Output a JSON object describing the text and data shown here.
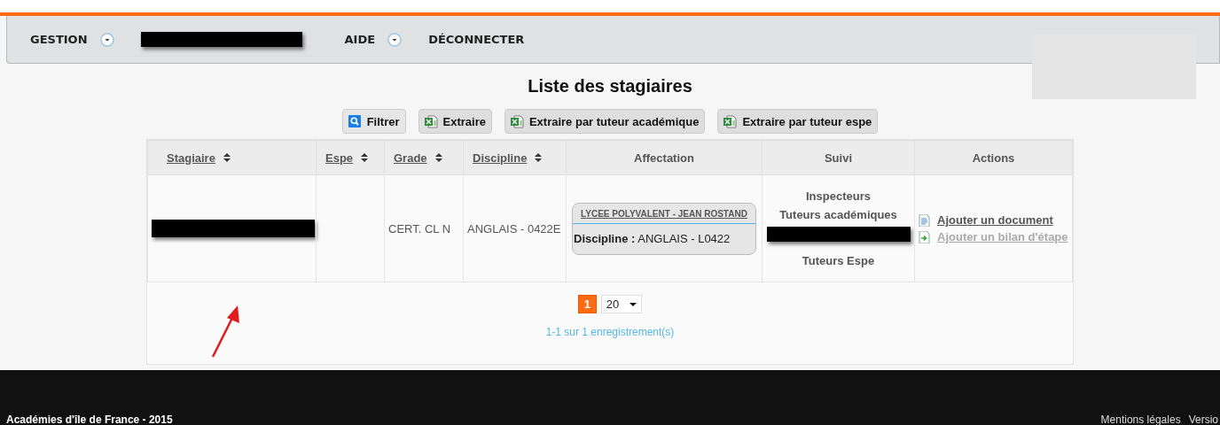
{
  "nav": {
    "items": [
      {
        "kind": "menu",
        "label": "GESTION"
      },
      {
        "kind": "redacted"
      },
      {
        "kind": "menu",
        "label": "AIDE"
      },
      {
        "kind": "link",
        "label": "DÉCONNECTER"
      }
    ]
  },
  "title": "Liste des stagiaires",
  "toolbar": [
    {
      "kind": "search",
      "label": "Filtrer"
    },
    {
      "kind": "excel",
      "label": "Extraire"
    },
    {
      "kind": "excel",
      "label": "Extraire par tuteur académique"
    },
    {
      "kind": "excel",
      "label": "Extraire par tuteur espe"
    }
  ],
  "table": {
    "columns": [
      {
        "label": "Stagiaire",
        "sortable": true
      },
      {
        "label": "Espe",
        "sortable": true
      },
      {
        "label": "Grade",
        "sortable": true
      },
      {
        "label": "Discipline",
        "sortable": true
      },
      {
        "label": "Affectation",
        "sortable": false
      },
      {
        "label": "Suivi",
        "sortable": false
      },
      {
        "label": "Actions",
        "sortable": false
      }
    ],
    "rows": [
      {
        "stagiaire": {
          "redacted": true
        },
        "grade": "CERT. CL N",
        "discipline": "ANGLAIS - 0422E",
        "affectation": {
          "school": "LYCEE POLYVALENT - JEAN ROSTAND",
          "label": "Discipline :",
          "value": "ANGLAIS - L0422"
        },
        "suivi": [
          {
            "kind": "heading",
            "text": "Inspecteurs"
          },
          {
            "kind": "heading",
            "text": "Tuteurs académiques"
          },
          {
            "kind": "redacted"
          },
          {
            "kind": "heading",
            "text": "Tuteurs Espe"
          }
        ],
        "actions": [
          {
            "label": "Ajouter un document",
            "disabled": false
          },
          {
            "label": "Ajouter un bilan d'étape",
            "disabled": true
          }
        ]
      }
    ]
  },
  "pagination": {
    "pages": [
      {
        "label": "1",
        "selected": true
      }
    ],
    "page_size": "20",
    "summary": "1-1 sur 1 enregistrement(s)"
  },
  "footer": {
    "left": "Académies d'île de France - 2015",
    "links": [
      "Mentions légales",
      "Versio"
    ]
  }
}
